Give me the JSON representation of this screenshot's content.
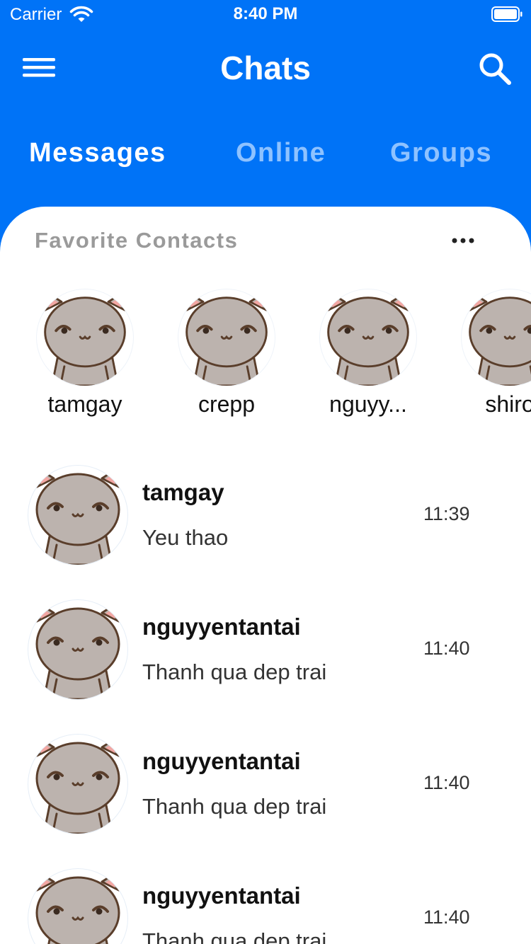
{
  "status_bar": {
    "carrier": "Carrier",
    "time": "8:40 PM"
  },
  "nav": {
    "title": "Chats",
    "menu_icon": "hamburger-menu-icon",
    "search_icon": "search-icon"
  },
  "tabs": [
    {
      "label": "Messages",
      "active": true
    },
    {
      "label": "Online",
      "active": false
    },
    {
      "label": "Groups",
      "active": false
    }
  ],
  "favorites": {
    "header": "Favorite Contacts",
    "more_icon": "more-horizontal-icon",
    "contacts": [
      {
        "name": "tamgay"
      },
      {
        "name": "crepp"
      },
      {
        "name": "nguyy..."
      },
      {
        "name": "shiro"
      }
    ]
  },
  "chats": [
    {
      "name": "tamgay",
      "message": "Yeu thao",
      "time": "11:39"
    },
    {
      "name": "nguyyentantai",
      "message": "Thanh qua dep trai",
      "time": "11:40"
    },
    {
      "name": "nguyyentantai",
      "message": "Thanh qua dep trai",
      "time": "11:40"
    },
    {
      "name": "nguyyentantai",
      "message": "Thanh qua dep trai",
      "time": "11:40"
    }
  ],
  "colors": {
    "primary": "#0073F7",
    "inactive_tab": "#8EC2FF",
    "subtle_text": "#9A9A9A",
    "panel": "#FFFFFF"
  }
}
